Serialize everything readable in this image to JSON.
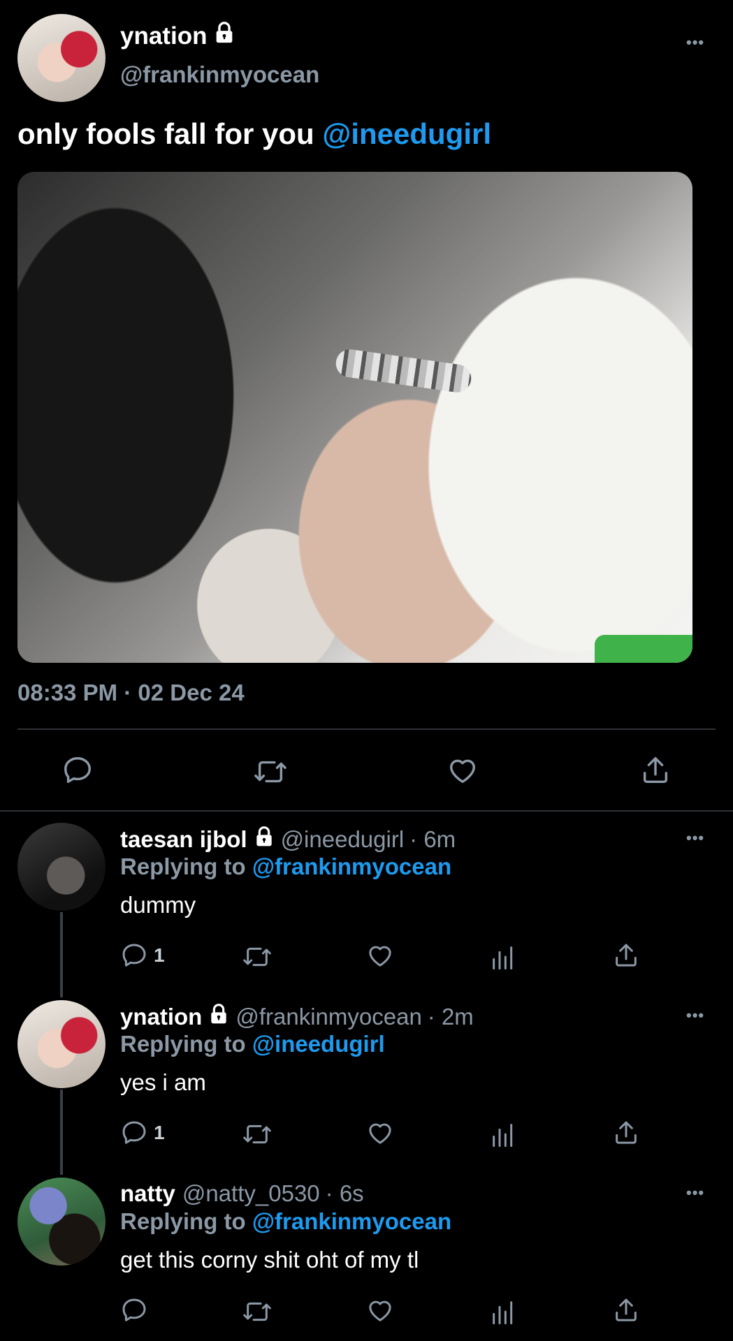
{
  "colors": {
    "background": "#000000",
    "accent": "#1d9bf0",
    "muted": "#8b98a5",
    "divider": "#2f3336"
  },
  "main_tweet": {
    "display_name": "ynation",
    "handle": "@frankinmyocean",
    "text": "only fools fall for you",
    "mention": "@ineedugirl",
    "timestamp": "08:33 PM · 02 Dec 24",
    "more_icon": "more-horizontal-icon",
    "lock_icon": "lock-icon",
    "photo_icon": "photo"
  },
  "actions_main": [
    "reply-icon",
    "retweet-icon",
    "like-icon",
    "share-icon"
  ],
  "replies": [
    {
      "display_name": "taesan ijbol",
      "handle": "@ineedugirl",
      "time": "· 6m",
      "replying_to_label": "Replying to",
      "replying_to": "@frankinmyocean",
      "text": "dummy",
      "reply_count": "1"
    },
    {
      "display_name": "ynation",
      "handle": "@frankinmyocean",
      "time": "· 2m",
      "replying_to_label": "Replying to",
      "replying_to": "@ineedugirl",
      "text": "yes i am",
      "reply_count": "1"
    },
    {
      "display_name": "natty",
      "handle": "@natty_0530",
      "time": "· 6s",
      "replying_to_label": "Replying to",
      "replying_to": "@frankinmyocean",
      "text": "get this corny shit oht of my tl",
      "reply_count": ""
    }
  ],
  "more_dots": "•••"
}
